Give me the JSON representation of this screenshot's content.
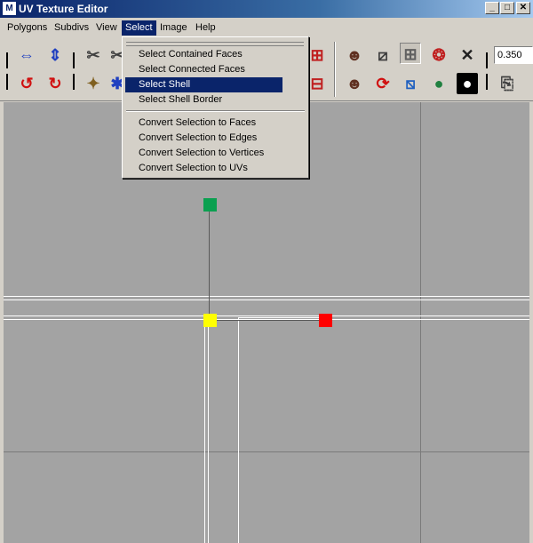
{
  "window": {
    "title": "UV Texture Editor",
    "app_icon": "M",
    "minimize": "_",
    "maximize": "□",
    "close": "✕"
  },
  "menubar": [
    {
      "label": "Polygons"
    },
    {
      "label": "Subdivs"
    },
    {
      "label": "View"
    },
    {
      "label": "Select",
      "open": true
    },
    {
      "label": "Image"
    },
    {
      "label": "Help"
    }
  ],
  "toolbar": {
    "value": "0.350"
  },
  "select_menu": {
    "items": [
      {
        "label": "Select Contained Faces"
      },
      {
        "label": "Select Connected Faces"
      },
      {
        "label": "Select Shell",
        "highlighted": true
      },
      {
        "label": "Select Shell Border"
      },
      {
        "label": "Convert Selection to Faces"
      },
      {
        "label": "Convert Selection to Edges"
      },
      {
        "label": "Convert Selection to Vertices"
      },
      {
        "label": "Convert Selection to UVs"
      }
    ]
  },
  "colors": {
    "canvas": "#a3a3a3",
    "uv_green": "#0aa050",
    "uv_yellow": "#ffff00",
    "uv_red": "#ff0000",
    "highlight": "#0a246a"
  }
}
